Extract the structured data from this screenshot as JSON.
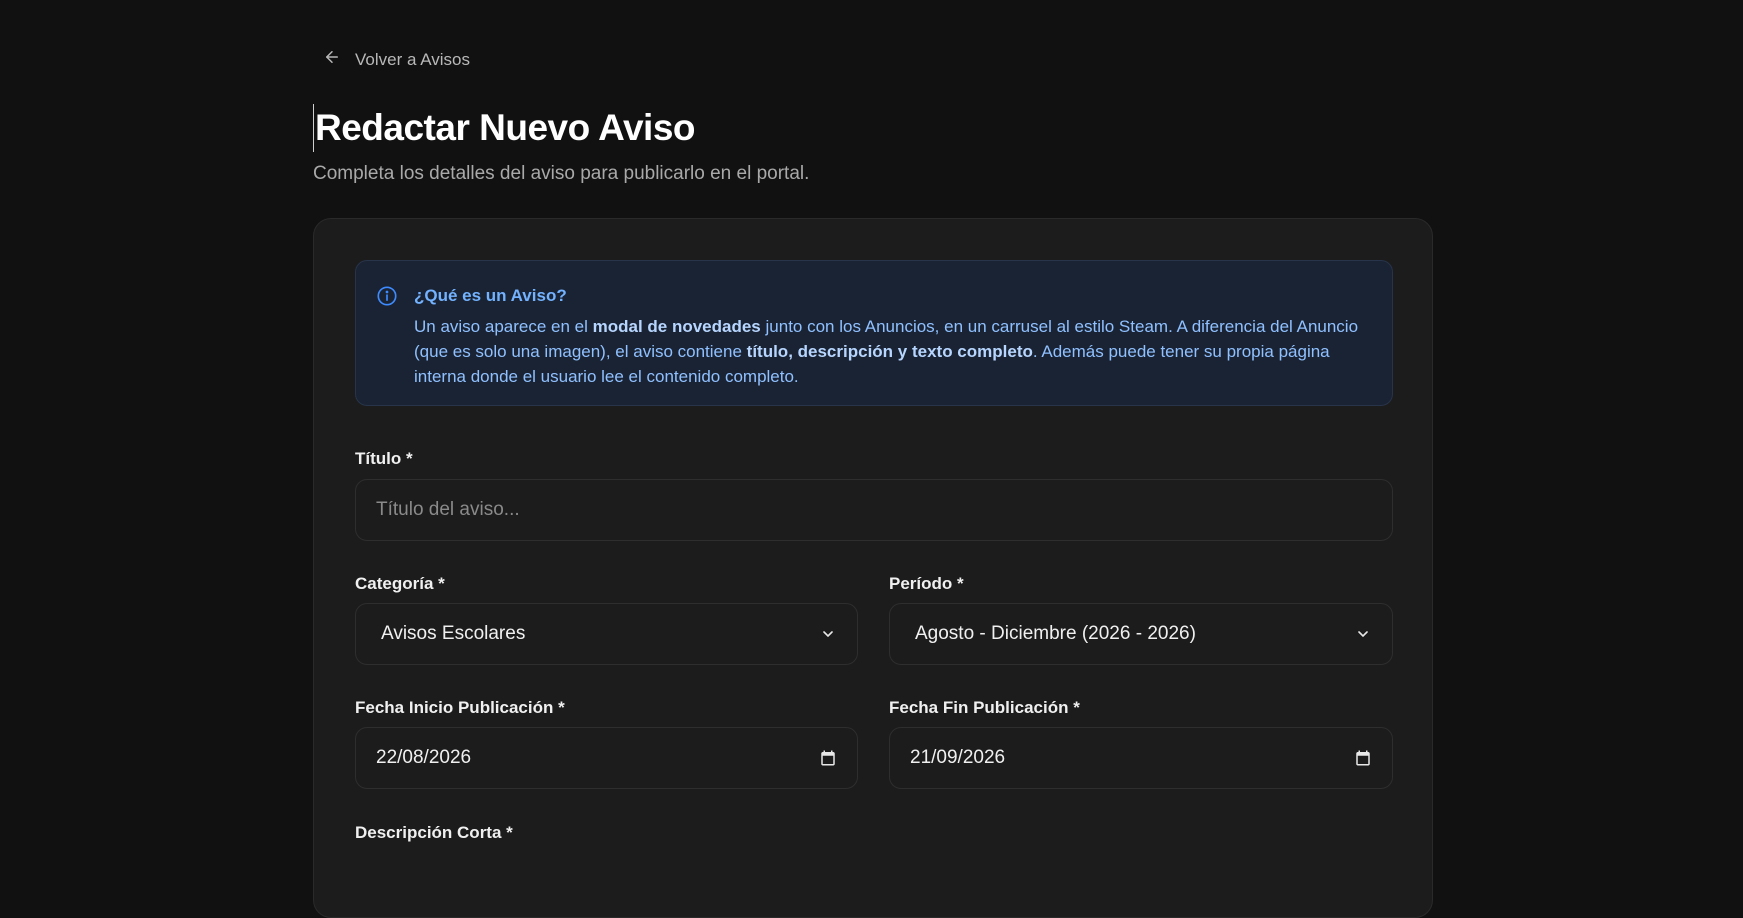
{
  "back_link": {
    "label": "Volver a Avisos",
    "icon": "arrow-left-icon"
  },
  "header": {
    "title": "Redactar Nuevo Aviso",
    "subtitle": "Completa los detalles del aviso para publicarlo en el portal."
  },
  "info_box": {
    "icon": "info-circle-icon",
    "title": "¿Qué es un Aviso?",
    "body_1": "Un aviso aparece en el ",
    "body_bold_1": "modal de novedades",
    "body_2": " junto con los Anuncios, en un carrusel al estilo Steam. A diferencia del Anuncio (que es solo una imagen), el aviso contiene ",
    "body_bold_2": "título, descripción y texto completo",
    "body_3": ". Además puede tener su propia página interna donde el usuario lee el contenido completo."
  },
  "form": {
    "title_label": "Título *",
    "title_placeholder": "Título del aviso...",
    "title_value": "",
    "category_label": "Categoría *",
    "category_value": "Avisos Escolares",
    "period_label": "Período *",
    "period_value": "Agosto - Diciembre (2026 - 2026)",
    "start_date_label": "Fecha Inicio Publicación *",
    "start_date_value": "22/08/2026",
    "end_date_label": "Fecha Fin Publicación *",
    "end_date_value": "21/09/2026",
    "short_desc_label": "Descripción Corta *"
  },
  "colors": {
    "background": "#111111",
    "card": "#1c1c1c",
    "info_bg": "#1a2333",
    "info_accent": "#72b2ff"
  }
}
